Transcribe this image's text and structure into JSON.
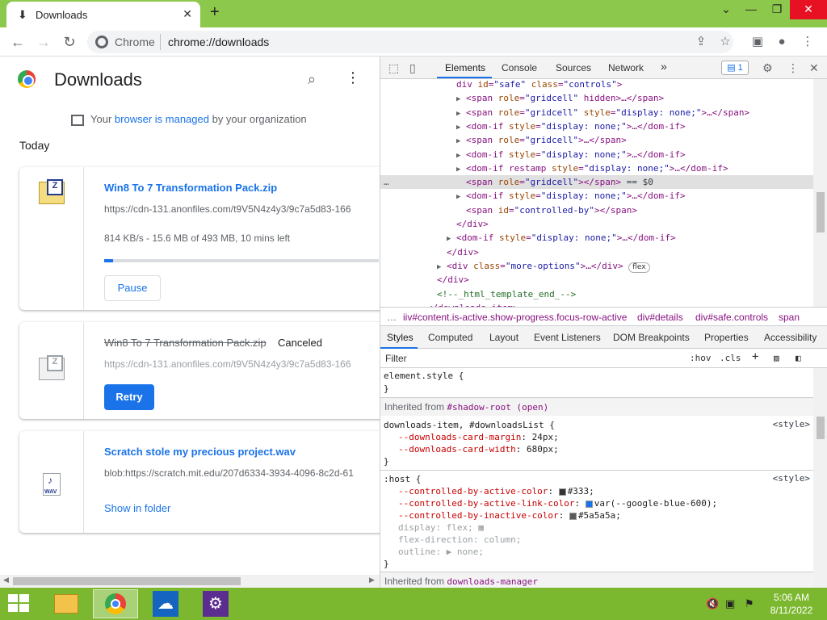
{
  "browser": {
    "tab_title": "Downloads",
    "scheme_label": "Chrome",
    "url": "chrome://downloads"
  },
  "downloads": {
    "title": "Downloads",
    "managed_prefix": "Your",
    "managed_link": "browser is managed",
    "managed_suffix": "by your organization",
    "section": "Today",
    "items": [
      {
        "name": "Win8 To 7 Transformation Pack.zip",
        "url": "https://cdn-131.anonfiles.com/t9V5N4z4y3/9c7a5d83-166",
        "progress_text": "814 KB/s - 15.6 MB of 493 MB, 10 mins left",
        "progress_fraction": 0.032,
        "action": "Pause"
      },
      {
        "name": "Win8 To 7 Transformation Pack.zip",
        "status": "Canceled",
        "url": "https://cdn-131.anonfiles.com/t9V5N4z4y3/9c7a5d83-166",
        "action": "Retry"
      },
      {
        "name": "Scratch stole my precious project.wav",
        "url": "blob:https://scratch.mit.edu/207d6334-3934-4096-8c2d-61",
        "icon_label": "WAV",
        "action": "Show in folder"
      }
    ]
  },
  "devtools": {
    "tabs": [
      "Elements",
      "Console",
      "Sources",
      "Network"
    ],
    "more": "»",
    "issues_count": "1",
    "dom_lines": [
      {
        "indent": 9,
        "tri": "",
        "html": "div id=\"safe\" class=\"controls\">"
      },
      {
        "indent": 10,
        "tri": "▶",
        "html": "<span role=\"gridcell\" hidden>…</span>"
      },
      {
        "indent": 10,
        "tri": "▶",
        "html": "<span role=\"gridcell\" style=\"display: none;\">…</span>"
      },
      {
        "indent": 10,
        "tri": "▶",
        "html": "<dom-if style=\"display: none;\">…</dom-if>"
      },
      {
        "indent": 10,
        "tri": "▶",
        "html": "<span role=\"gridcell\">…</span>"
      },
      {
        "indent": 10,
        "tri": "▶",
        "html": "<dom-if style=\"display: none;\">…</dom-if>"
      },
      {
        "indent": 10,
        "tri": "▶",
        "html": "<dom-if restamp style=\"display: none;\">…</dom-if>"
      },
      {
        "indent": 10,
        "tri": "",
        "html": "<span role=\"gridcell\"></span> == $0",
        "sel": true
      },
      {
        "indent": 10,
        "tri": "▶",
        "html": "<dom-if style=\"display: none;\">…</dom-if>"
      },
      {
        "indent": 10,
        "tri": "",
        "html": "<span id=\"controlled-by\"></span>"
      },
      {
        "indent": 9,
        "tri": "",
        "html": "</div>"
      },
      {
        "indent": 9,
        "tri": "▶",
        "html": "<dom-if style=\"display: none;\">…</dom-if>"
      },
      {
        "indent": 8,
        "tri": "",
        "html": "</div>"
      },
      {
        "indent": 8,
        "tri": "▶",
        "html": "<div class=\"more-options\">…</div>",
        "badge": "flex"
      },
      {
        "indent": 7,
        "tri": "",
        "html": "</div>"
      },
      {
        "indent": 7,
        "tri": "",
        "html": "<!--_html_template_end_-->",
        "comment": true
      },
      {
        "indent": 6,
        "tri": "",
        "html": "</downloads-item>"
      }
    ],
    "crumbs": [
      "…",
      "iiv#content.is-active.show-progress.focus-row-active",
      "div#details",
      "div#safe.controls",
      "span"
    ],
    "style_tabs": [
      "Styles",
      "Computed",
      "Layout",
      "Event Listeners",
      "DOM Breakpoints",
      "Properties",
      "Accessibility"
    ],
    "filter_placeholder": "Filter",
    "hov": ":hov",
    "cls": ".cls",
    "element_style": "element.style {",
    "close_brace": "}",
    "inherited_1_label": "Inherited from",
    "inherited_1_key": "#shadow-root (open)",
    "rule1_selector": "downloads-item, #downloadsList {",
    "rule1_source": "<style>",
    "rule1_props": [
      {
        "name": "--downloads-card-margin",
        "value": "24px;"
      },
      {
        "name": "--downloads-card-width",
        "value": "680px;"
      }
    ],
    "rule2_selector": ":host {",
    "rule2_source": "<style>",
    "rule2_props": [
      {
        "name": "--controlled-by-active-color",
        "value": "#333;",
        "swatch": "#333333"
      },
      {
        "name": "--controlled-by-active-link-color",
        "value": "var(--google-blue-600);",
        "swatch": "#1a73e8"
      },
      {
        "name": "--controlled-by-inactive-color",
        "value": "#5a5a5a;",
        "swatch": "#5a5a5a"
      }
    ],
    "rule2_dim_props": [
      {
        "name": "display",
        "value": "flex;"
      },
      {
        "name": "flex-direction",
        "value": "column;"
      },
      {
        "name": "outline",
        "value": "▶ none;"
      }
    ],
    "inherited_2_label": "Inherited from",
    "inherited_2_key": "downloads-manager"
  },
  "taskbar": {
    "time": "5:06 AM",
    "date": "8/11/2022"
  },
  "colors": {
    "accent": "#1a73e8",
    "titlebar": "#8cc84b",
    "taskbar": "#7cb82f"
  }
}
